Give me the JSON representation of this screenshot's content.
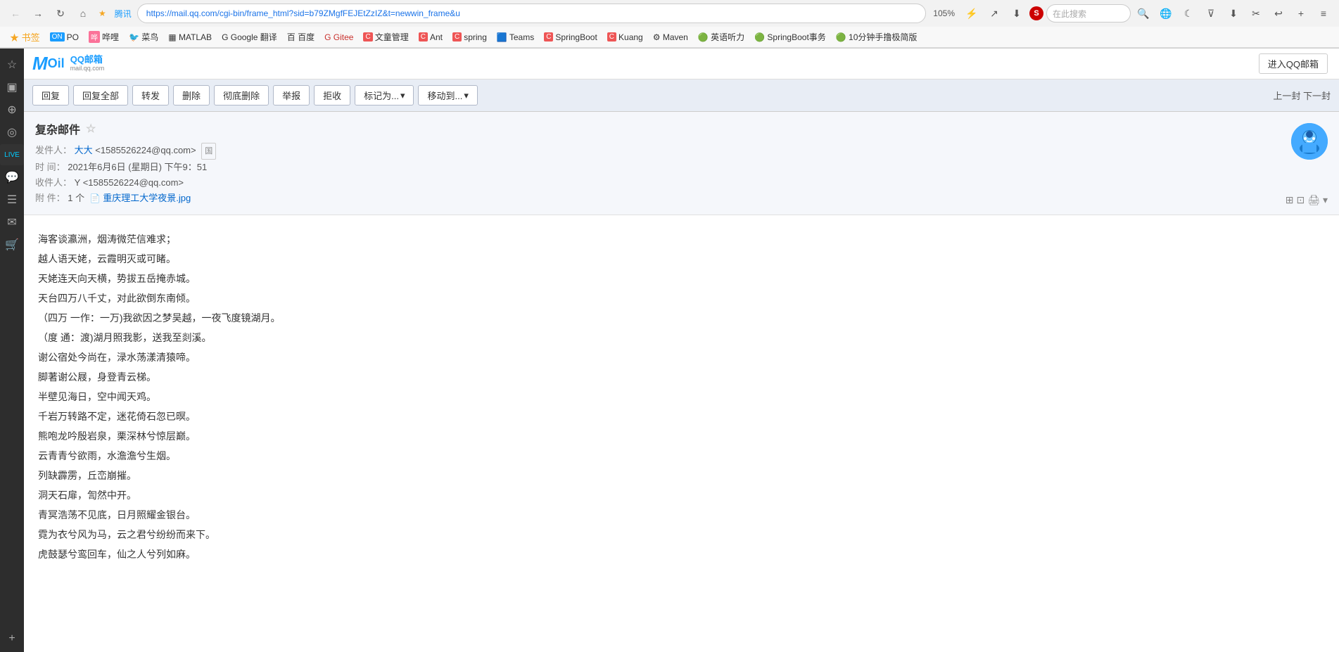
{
  "browser": {
    "back_disabled": true,
    "forward_disabled": false,
    "url": "https://mail.qq.com/cgi-bin/frame_html?sid=b79ZMgfFEJEtZzIZ&t=newwin_frame&u",
    "zoom": "105%",
    "search_placeholder": "在此搜索",
    "bookmarks": [
      {
        "label": "书签",
        "icon": "★"
      },
      {
        "label": "ON PO",
        "icon": ""
      },
      {
        "label": "哗哩",
        "icon": ""
      },
      {
        "label": "菜鸟",
        "icon": ""
      },
      {
        "label": "MATLAB",
        "icon": ""
      },
      {
        "label": "Google 翻译",
        "icon": ""
      },
      {
        "label": "百度",
        "icon": ""
      },
      {
        "label": "Gitee",
        "icon": ""
      },
      {
        "label": "文童管理",
        "icon": ""
      },
      {
        "label": "Ant",
        "icon": ""
      },
      {
        "label": "spring",
        "icon": ""
      },
      {
        "label": "Teams",
        "icon": ""
      },
      {
        "label": "SpringBoot",
        "icon": ""
      },
      {
        "label": "Kuang",
        "icon": ""
      },
      {
        "label": "Maven",
        "icon": ""
      },
      {
        "label": "英语听力",
        "icon": ""
      },
      {
        "label": "SpringBoot事务",
        "icon": ""
      },
      {
        "label": "10分钟手撸极简版",
        "icon": ""
      }
    ]
  },
  "sidebar": {
    "icons": [
      "☆",
      "▣",
      "⊕",
      "◎",
      "LIVE",
      "💬",
      "☰",
      "📧",
      "🛒",
      "+"
    ]
  },
  "topbar": {
    "logo": "MOil QQ邮箱",
    "enter_btn": "进入QQ邮箱"
  },
  "toolbar": {
    "reply": "回复",
    "reply_all": "回复全部",
    "forward": "转发",
    "delete": "删除",
    "delete_perm": "彻底删除",
    "report": "举报",
    "reject": "拒收",
    "mark_as": "标记为...",
    "move_to": "移动到...",
    "prev_next": "上一封 下一封"
  },
  "email": {
    "subject": "复杂邮件",
    "star": "☆",
    "from_label": "发件人：",
    "from_name": "大大",
    "from_email": "<1585526224@qq.com>",
    "time_label": "时  间：",
    "time_value": "2021年6月6日 (星期日) 下午9：51",
    "to_label": "收件人：",
    "to_value": "Y <1585526224@qq.com>",
    "attach_label": "附  件：",
    "attach_count": "1 个",
    "attach_filename": "重庆理工大学夜景.jpg",
    "body_lines": [
      "海客谈瀛洲，烟涛微茫信难求；",
      "越人语天姥，云霞明灭或可睹。",
      "天姥连天向天横，势拔五岳掩赤城。",
      "天台四万八千丈，对此欲倒东南倾。",
      "（四万 一作：一万)我欲因之梦吴越，一夜飞度镜湖月。",
      "（度 通：渡)湖月照我影，送我至剡溪。",
      "谢公宿处今尚在，渌水荡漾清猿啼。",
      "",
      "脚著谢公屐，身登青云梯。",
      "半壁见海日，空中闻天鸡。",
      "千岩万转路不定，迷花倚石忽已暝。",
      "熊咆龙吟殷岩泉，栗深林兮惊层巅。",
      "云青青兮欲雨，水澹澹兮生烟。",
      "列缺霹雳，丘峦崩摧。",
      "",
      "洞天石扉，訇然中开。",
      "青冥浩荡不见底，日月照耀金银台。",
      "霓为衣兮风为马，云之君兮纷纷而来下。",
      "虎鼓瑟兮鸾回车，仙之人兮列如麻。"
    ]
  }
}
